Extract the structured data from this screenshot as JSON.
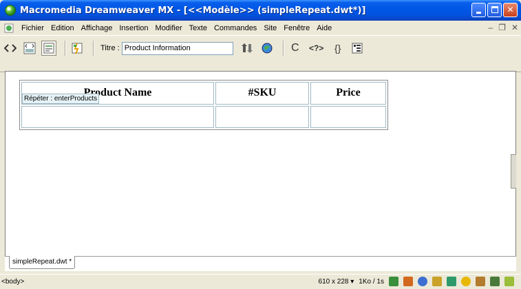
{
  "window": {
    "title": "Macromedia Dreamweaver MX - [<<Modèle>> (simpleRepeat.dwt*)]"
  },
  "menu": {
    "items": [
      "Fichier",
      "Edition",
      "Affichage",
      "Insertion",
      "Modifier",
      "Texte",
      "Commandes",
      "Site",
      "Fenêtre",
      "Aide"
    ]
  },
  "toolbar": {
    "titre_label": "Titre :",
    "titre_value": "Product Information"
  },
  "document": {
    "table_headers": [
      "Product Name",
      "#SKU",
      "Price"
    ],
    "repeat_tag": "Répéter : enterProducts",
    "tab_label": "simpleRepeat.dwt *"
  },
  "status": {
    "tag_selector": "<body>",
    "window_size": "610 x 228",
    "download": "1Ko / 1s"
  },
  "colors": {
    "titlebar": "#0058E6",
    "chrome": "#ECE9D8",
    "table_border": "#9FB7C4"
  }
}
